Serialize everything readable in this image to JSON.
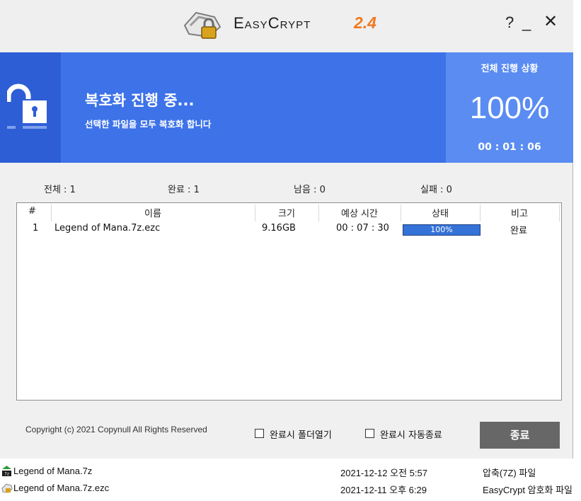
{
  "titlebar": {
    "app_name": "EasyCrypt",
    "version": "2.4",
    "help": "?",
    "minimize": "_",
    "close": "✕"
  },
  "banner": {
    "title": "복호화 진행 중...",
    "subtitle": "선택한 파일을 모두 복호화 합니다",
    "overall_label": "전체 진행 상황",
    "overall_percent": "100%",
    "elapsed": "00 : 01 : 06"
  },
  "stats": {
    "total": "전체 : 1",
    "done": "완료 : 1",
    "remaining": "남음 : 0",
    "failed": "실패 : 0"
  },
  "list": {
    "columns": [
      "#",
      "이름",
      "크기",
      "예상 시간",
      "상태",
      "비고"
    ],
    "rows": [
      {
        "num": "1",
        "name": "Legend of Mana.7z.ezc",
        "size": "9.16GB",
        "eta": "00 : 07 : 30",
        "status": "100%",
        "progress": 1.0,
        "note": "완료"
      }
    ]
  },
  "footer": {
    "copyright": "Copyright (c) 2021 Copynull All Rights Reserved",
    "open_folder": "완료시 폴더열기",
    "auto_exit": "완료시 자동종료",
    "exit_button": "종료"
  },
  "explorer_rows": [
    {
      "name": "Legend of Mana.7z",
      "date": "2021-12-12 오전 5:57",
      "type": "압축(7Z) 파일",
      "icon": "7z-archive-icon"
    },
    {
      "name": "Legend of Mana.7z.ezc",
      "date": "2021-12-11 오후 6:29",
      "type": "EasyCrypt 암호화 파일",
      "icon": "easycrypt-file-icon"
    }
  ],
  "colors": {
    "banner": "#3d72e8",
    "banner_dark": "#2d5ed6",
    "overall_panel": "#5a8cf2",
    "version_accent": "#f07820",
    "progress": "#3572d8",
    "exit_button": "#676767"
  }
}
